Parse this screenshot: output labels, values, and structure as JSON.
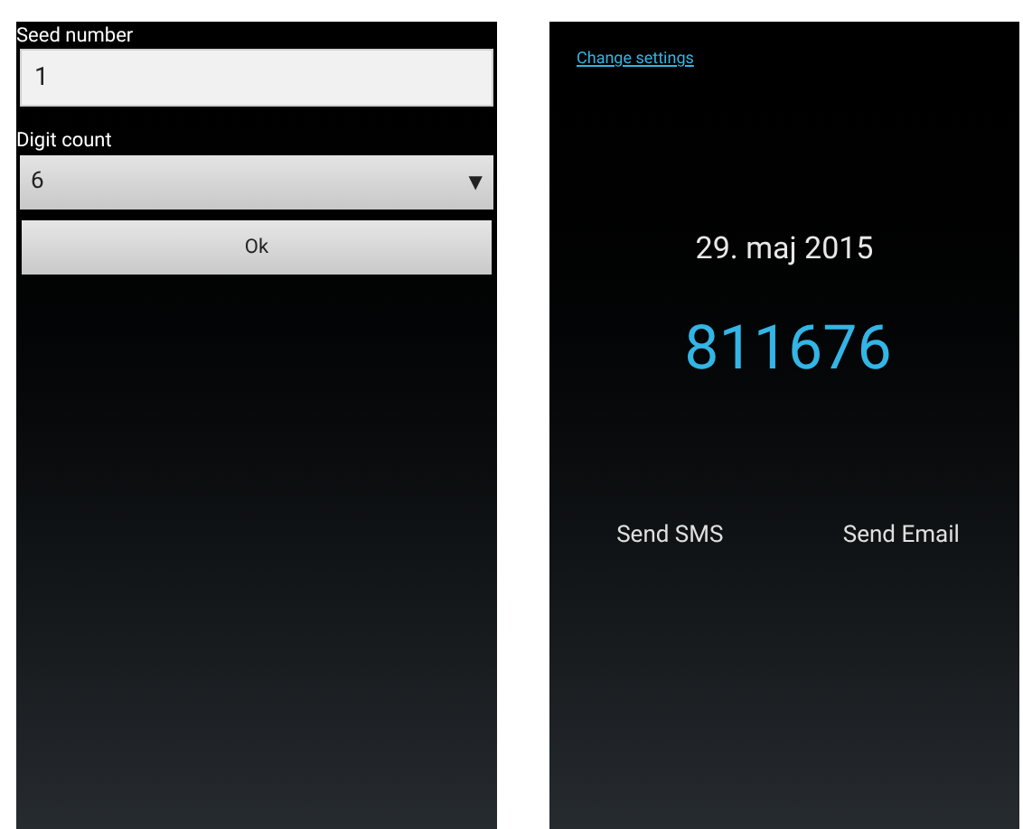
{
  "settings_screen": {
    "seed_number": {
      "label": "Seed number",
      "value": "1"
    },
    "digit_count": {
      "label": "Digit count",
      "value": "6",
      "caret": "▼"
    },
    "ok_button": "Ok"
  },
  "code_screen": {
    "change_settings_link": "Change settings",
    "date": "29. maj 2015",
    "code": "811676",
    "actions": [
      "Send SMS",
      "Send Email"
    ]
  }
}
